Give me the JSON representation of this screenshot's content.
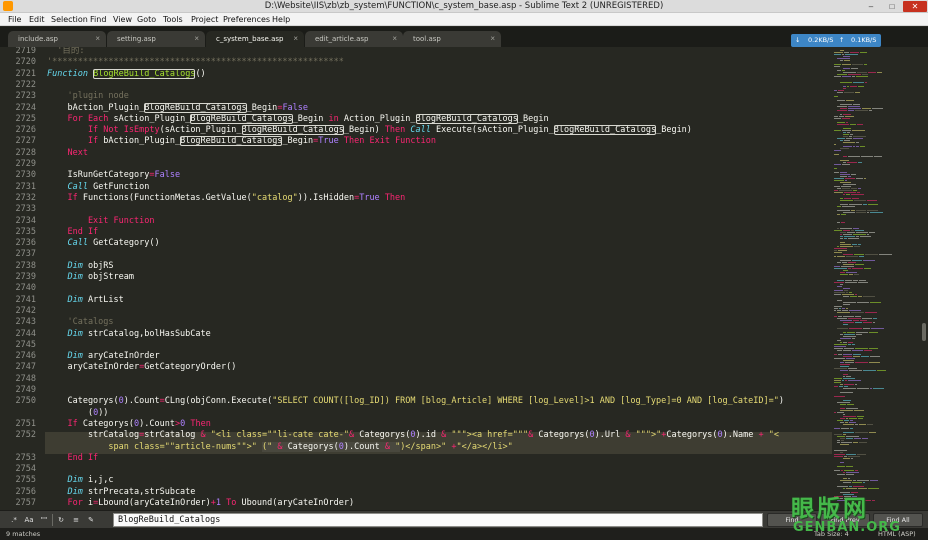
{
  "window": {
    "title": "D:\\Website\\IIS\\zb\\zb_system\\FUNCTION\\c_system_base.asp - Sublime Text 2 (UNREGISTERED)",
    "minimize": "–",
    "maximize": "□",
    "close": "✕"
  },
  "menu": [
    "File",
    "Edit",
    "Selection",
    "Find",
    "View",
    "Goto",
    "Tools",
    "Project",
    "Preferences",
    "Help"
  ],
  "tabs": [
    {
      "label": "include.asp",
      "active": false
    },
    {
      "label": "setting.asp",
      "active": false
    },
    {
      "label": "c_system_base.asp",
      "active": true
    },
    {
      "label": "edit_article.asp",
      "active": false
    },
    {
      "label": "tool.asp",
      "active": false
    }
  ],
  "tab_close_glyph": "×",
  "net_monitor": {
    "down": "0.2KB/S",
    "up": "0.1KB/S"
  },
  "search_term": "BlogReBuild_Catalogs",
  "code_lines": [
    {
      "n": "2719",
      "segs": [
        [
          "c",
          "  '目的:"
        ]
      ]
    },
    {
      "n": "2720",
      "segs": [
        [
          "c",
          "'*********************************************************"
        ]
      ]
    },
    {
      "n": "2721",
      "segs": [
        [
          "kb",
          "Function"
        ],
        [
          "",
          " "
        ],
        [
          "fh",
          "BlogReBuild_Catalogs"
        ],
        [
          "",
          "()"
        ]
      ]
    },
    {
      "n": "2722",
      "segs": []
    },
    {
      "n": "2723",
      "segs": [
        [
          "c",
          "    'plugin node"
        ]
      ]
    },
    {
      "n": "2724",
      "segs": [
        [
          "",
          "    bAction_Plugin_"
        ],
        [
          "h",
          "BlogReBuild_Catalogs"
        ],
        [
          "",
          "_Begin"
        ],
        [
          "k",
          "="
        ],
        [
          "n",
          "False"
        ]
      ]
    },
    {
      "n": "2725",
      "segs": [
        [
          "k",
          "    For Each"
        ],
        [
          "",
          " sAction_Plugin_"
        ],
        [
          "h",
          "BlogReBuild_Catalogs"
        ],
        [
          "",
          "_Begin "
        ],
        [
          "k",
          "in"
        ],
        [
          "",
          " Action_Plugin_"
        ],
        [
          "h",
          "BlogReBuild_Catalogs"
        ],
        [
          "",
          "_Begin"
        ]
      ]
    },
    {
      "n": "2726",
      "segs": [
        [
          "k",
          "        If Not"
        ],
        [
          "",
          " "
        ],
        [
          "k",
          "IsEmpty"
        ],
        [
          "",
          "(sAction_Plugin_"
        ],
        [
          "h",
          "BlogReBuild_Catalogs"
        ],
        [
          "",
          "_Begin) "
        ],
        [
          "k",
          "Then"
        ],
        [
          "",
          " "
        ],
        [
          "kb",
          "Call"
        ],
        [
          "",
          " Execute(sAction_Plugin_"
        ],
        [
          "h",
          "BlogReBuild_Catalogs"
        ],
        [
          "",
          "_Begin)"
        ]
      ]
    },
    {
      "n": "2727",
      "segs": [
        [
          "k",
          "        If"
        ],
        [
          "",
          " bAction_Plugin_"
        ],
        [
          "h",
          "BlogReBuild_Catalogs"
        ],
        [
          "",
          "_Begin"
        ],
        [
          "k",
          "="
        ],
        [
          "n",
          "True"
        ],
        [
          "",
          " "
        ],
        [
          "k",
          "Then Exit Function"
        ]
      ]
    },
    {
      "n": "2728",
      "segs": [
        [
          "k",
          "    Next"
        ]
      ]
    },
    {
      "n": "2729",
      "segs": []
    },
    {
      "n": "2730",
      "segs": [
        [
          "",
          "    IsRunGetCategory"
        ],
        [
          "k",
          "="
        ],
        [
          "n",
          "False"
        ]
      ]
    },
    {
      "n": "2731",
      "segs": [
        [
          "kb",
          "    Call"
        ],
        [
          "",
          " GetFunction"
        ]
      ]
    },
    {
      "n": "2732",
      "segs": [
        [
          "k",
          "    If"
        ],
        [
          "",
          " Functions(FunctionMetas.GetValue("
        ],
        [
          "s",
          "\"catalog\""
        ],
        [
          "",
          ")).IsHidden"
        ],
        [
          "k",
          "="
        ],
        [
          "n",
          "True"
        ],
        [
          "",
          " "
        ],
        [
          "k",
          "Then"
        ]
      ]
    },
    {
      "n": "2733",
      "segs": []
    },
    {
      "n": "2734",
      "segs": [
        [
          "k",
          "        Exit Function"
        ]
      ]
    },
    {
      "n": "2735",
      "segs": [
        [
          "k",
          "    End If"
        ]
      ]
    },
    {
      "n": "2736",
      "segs": [
        [
          "kb",
          "    Call"
        ],
        [
          "",
          " GetCategory()"
        ]
      ]
    },
    {
      "n": "2737",
      "segs": []
    },
    {
      "n": "2738",
      "segs": [
        [
          "kb",
          "    Dim"
        ],
        [
          "",
          " objRS"
        ]
      ]
    },
    {
      "n": "2739",
      "segs": [
        [
          "kb",
          "    Dim"
        ],
        [
          "",
          " objStream"
        ]
      ]
    },
    {
      "n": "2740",
      "segs": []
    },
    {
      "n": "2741",
      "segs": [
        [
          "kb",
          "    Dim"
        ],
        [
          "",
          " ArtList"
        ]
      ]
    },
    {
      "n": "2742",
      "segs": []
    },
    {
      "n": "2743",
      "segs": [
        [
          "c",
          "    'Catalogs"
        ]
      ]
    },
    {
      "n": "2744",
      "segs": [
        [
          "kb",
          "    Dim"
        ],
        [
          "",
          " strCatalog,bolHasSubCate"
        ]
      ]
    },
    {
      "n": "2745",
      "segs": []
    },
    {
      "n": "2746",
      "segs": [
        [
          "kb",
          "    Dim"
        ],
        [
          "",
          " aryCateInOrder"
        ]
      ]
    },
    {
      "n": "2747",
      "segs": [
        [
          "",
          "    aryCateInOrder"
        ],
        [
          "k",
          "="
        ],
        [
          "",
          "GetCategoryOrder()"
        ]
      ]
    },
    {
      "n": "2748",
      "segs": []
    },
    {
      "n": "2749",
      "segs": []
    },
    {
      "n": "2750",
      "segs": [
        [
          "",
          "    Categorys("
        ],
        [
          "n",
          "0"
        ],
        [
          "",
          ").Count"
        ],
        [
          "k",
          "="
        ],
        [
          "",
          "CLng(objConn.Execute("
        ],
        [
          "s",
          "\"SELECT COUNT([log_ID]) FROM [blog_Article] WHERE [log_Level]>1 AND [log_Type]=0 AND [log_CateID]=\""
        ],
        [
          "",
          ")"
        ]
      ]
    },
    {
      "n": "",
      "segs": [
        [
          "",
          "        ("
        ],
        [
          "n",
          "0"
        ],
        [
          "",
          "))"
        ]
      ]
    },
    {
      "n": "2751",
      "segs": [
        [
          "k",
          "    If"
        ],
        [
          "",
          " Categorys("
        ],
        [
          "n",
          "0"
        ],
        [
          "",
          ").Count"
        ],
        [
          "k",
          ">"
        ],
        [
          "n",
          "0"
        ],
        [
          "",
          " "
        ],
        [
          "k",
          "Then"
        ]
      ]
    },
    {
      "n": "2752",
      "segs": [
        [
          "",
          "        strCatalog"
        ],
        [
          "k",
          "="
        ],
        [
          "",
          "strCatalog "
        ],
        [
          "k",
          "&"
        ],
        [
          "",
          " "
        ],
        [
          "s",
          "\"<li class=\"\"li-cate cate-\""
        ],
        [
          "k",
          "&"
        ],
        [
          "",
          " Categorys("
        ],
        [
          "n",
          "0"
        ],
        [
          "",
          ").id "
        ],
        [
          "k",
          "&"
        ],
        [
          "",
          " "
        ],
        [
          "s",
          "\"\"\"><a href=\"\"\""
        ],
        [
          "k",
          "&"
        ],
        [
          "",
          " Categorys("
        ],
        [
          "n",
          "0"
        ],
        [
          "",
          ").Url "
        ],
        [
          "k",
          "&"
        ],
        [
          "",
          " "
        ],
        [
          "s",
          "\"\"\">\""
        ],
        [
          "k",
          "+"
        ],
        [
          "",
          "Categorys("
        ],
        [
          "n",
          "0"
        ],
        [
          "",
          ").Name "
        ],
        [
          "k",
          "+"
        ],
        [
          "",
          " "
        ],
        [
          "s",
          "\"<"
        ]
      ]
    },
    {
      "n": "",
      "segs": [
        [
          "s",
          "            span class=\"\"article-nums\"\">\""
        ],
        [
          "",
          " "
        ],
        [
          "sel_s",
          "(\""
        ],
        [
          "sel_k",
          " & "
        ],
        [
          "sel",
          "Categorys("
        ],
        [
          "sel_n",
          "0"
        ],
        [
          "sel",
          ").Count"
        ],
        [
          "sel_k",
          " & "
        ],
        [
          "sel_s",
          "\""
        ],
        [
          "s",
          ")</span>\""
        ],
        [
          "",
          " "
        ],
        [
          "k",
          "+"
        ],
        [
          "s",
          "\"</a></li>\""
        ]
      ]
    },
    {
      "n": "2753",
      "segs": [
        [
          "k",
          "    End If"
        ]
      ]
    },
    {
      "n": "2754",
      "segs": []
    },
    {
      "n": "2755",
      "segs": [
        [
          "kb",
          "    Dim"
        ],
        [
          "",
          " i,j,c"
        ]
      ]
    },
    {
      "n": "2756",
      "segs": [
        [
          "kb",
          "    Dim"
        ],
        [
          "",
          " strPrecata,strSubcate"
        ]
      ]
    },
    {
      "n": "2757",
      "segs": [
        [
          "k",
          "    For"
        ],
        [
          "",
          " i"
        ],
        [
          "k",
          "="
        ],
        [
          "",
          "Lbound(aryCateInOrder)"
        ],
        [
          "k",
          "+"
        ],
        [
          "n",
          "1"
        ],
        [
          "",
          " "
        ],
        [
          "k",
          "To"
        ],
        [
          "",
          " Ubound(aryCateInOrder)"
        ]
      ]
    }
  ],
  "find_panel": {
    "buttons": [
      {
        "name": "regex-toggle",
        "glyph": ".*"
      },
      {
        "name": "case-toggle",
        "glyph": "Aa"
      },
      {
        "name": "whole-word-toggle",
        "glyph": "\"\""
      },
      {
        "name": "wrap-toggle",
        "glyph": "↻"
      },
      {
        "name": "in-selection-toggle",
        "glyph": "≡"
      },
      {
        "name": "highlight-toggle",
        "glyph": "✎"
      }
    ],
    "find_label": "Find",
    "find_prev_label": "Find Prev",
    "find_all_label": "Find All"
  },
  "status": {
    "matches": "9 matches",
    "tab_size": "Tab Size: 4",
    "syntax": "HTML (ASP)"
  },
  "watermark": {
    "main": "眼版网",
    "sub": "GENBAN.ORG"
  },
  "colors": {
    "background": "#272822",
    "keyword": "#f92672",
    "storage": "#66d9ef",
    "function": "#a6e22e",
    "string": "#e6db74",
    "constant": "#ae81ff",
    "comment": "#75715e",
    "watermark": "#45b84a",
    "net_monitor": "#3d86c6"
  }
}
